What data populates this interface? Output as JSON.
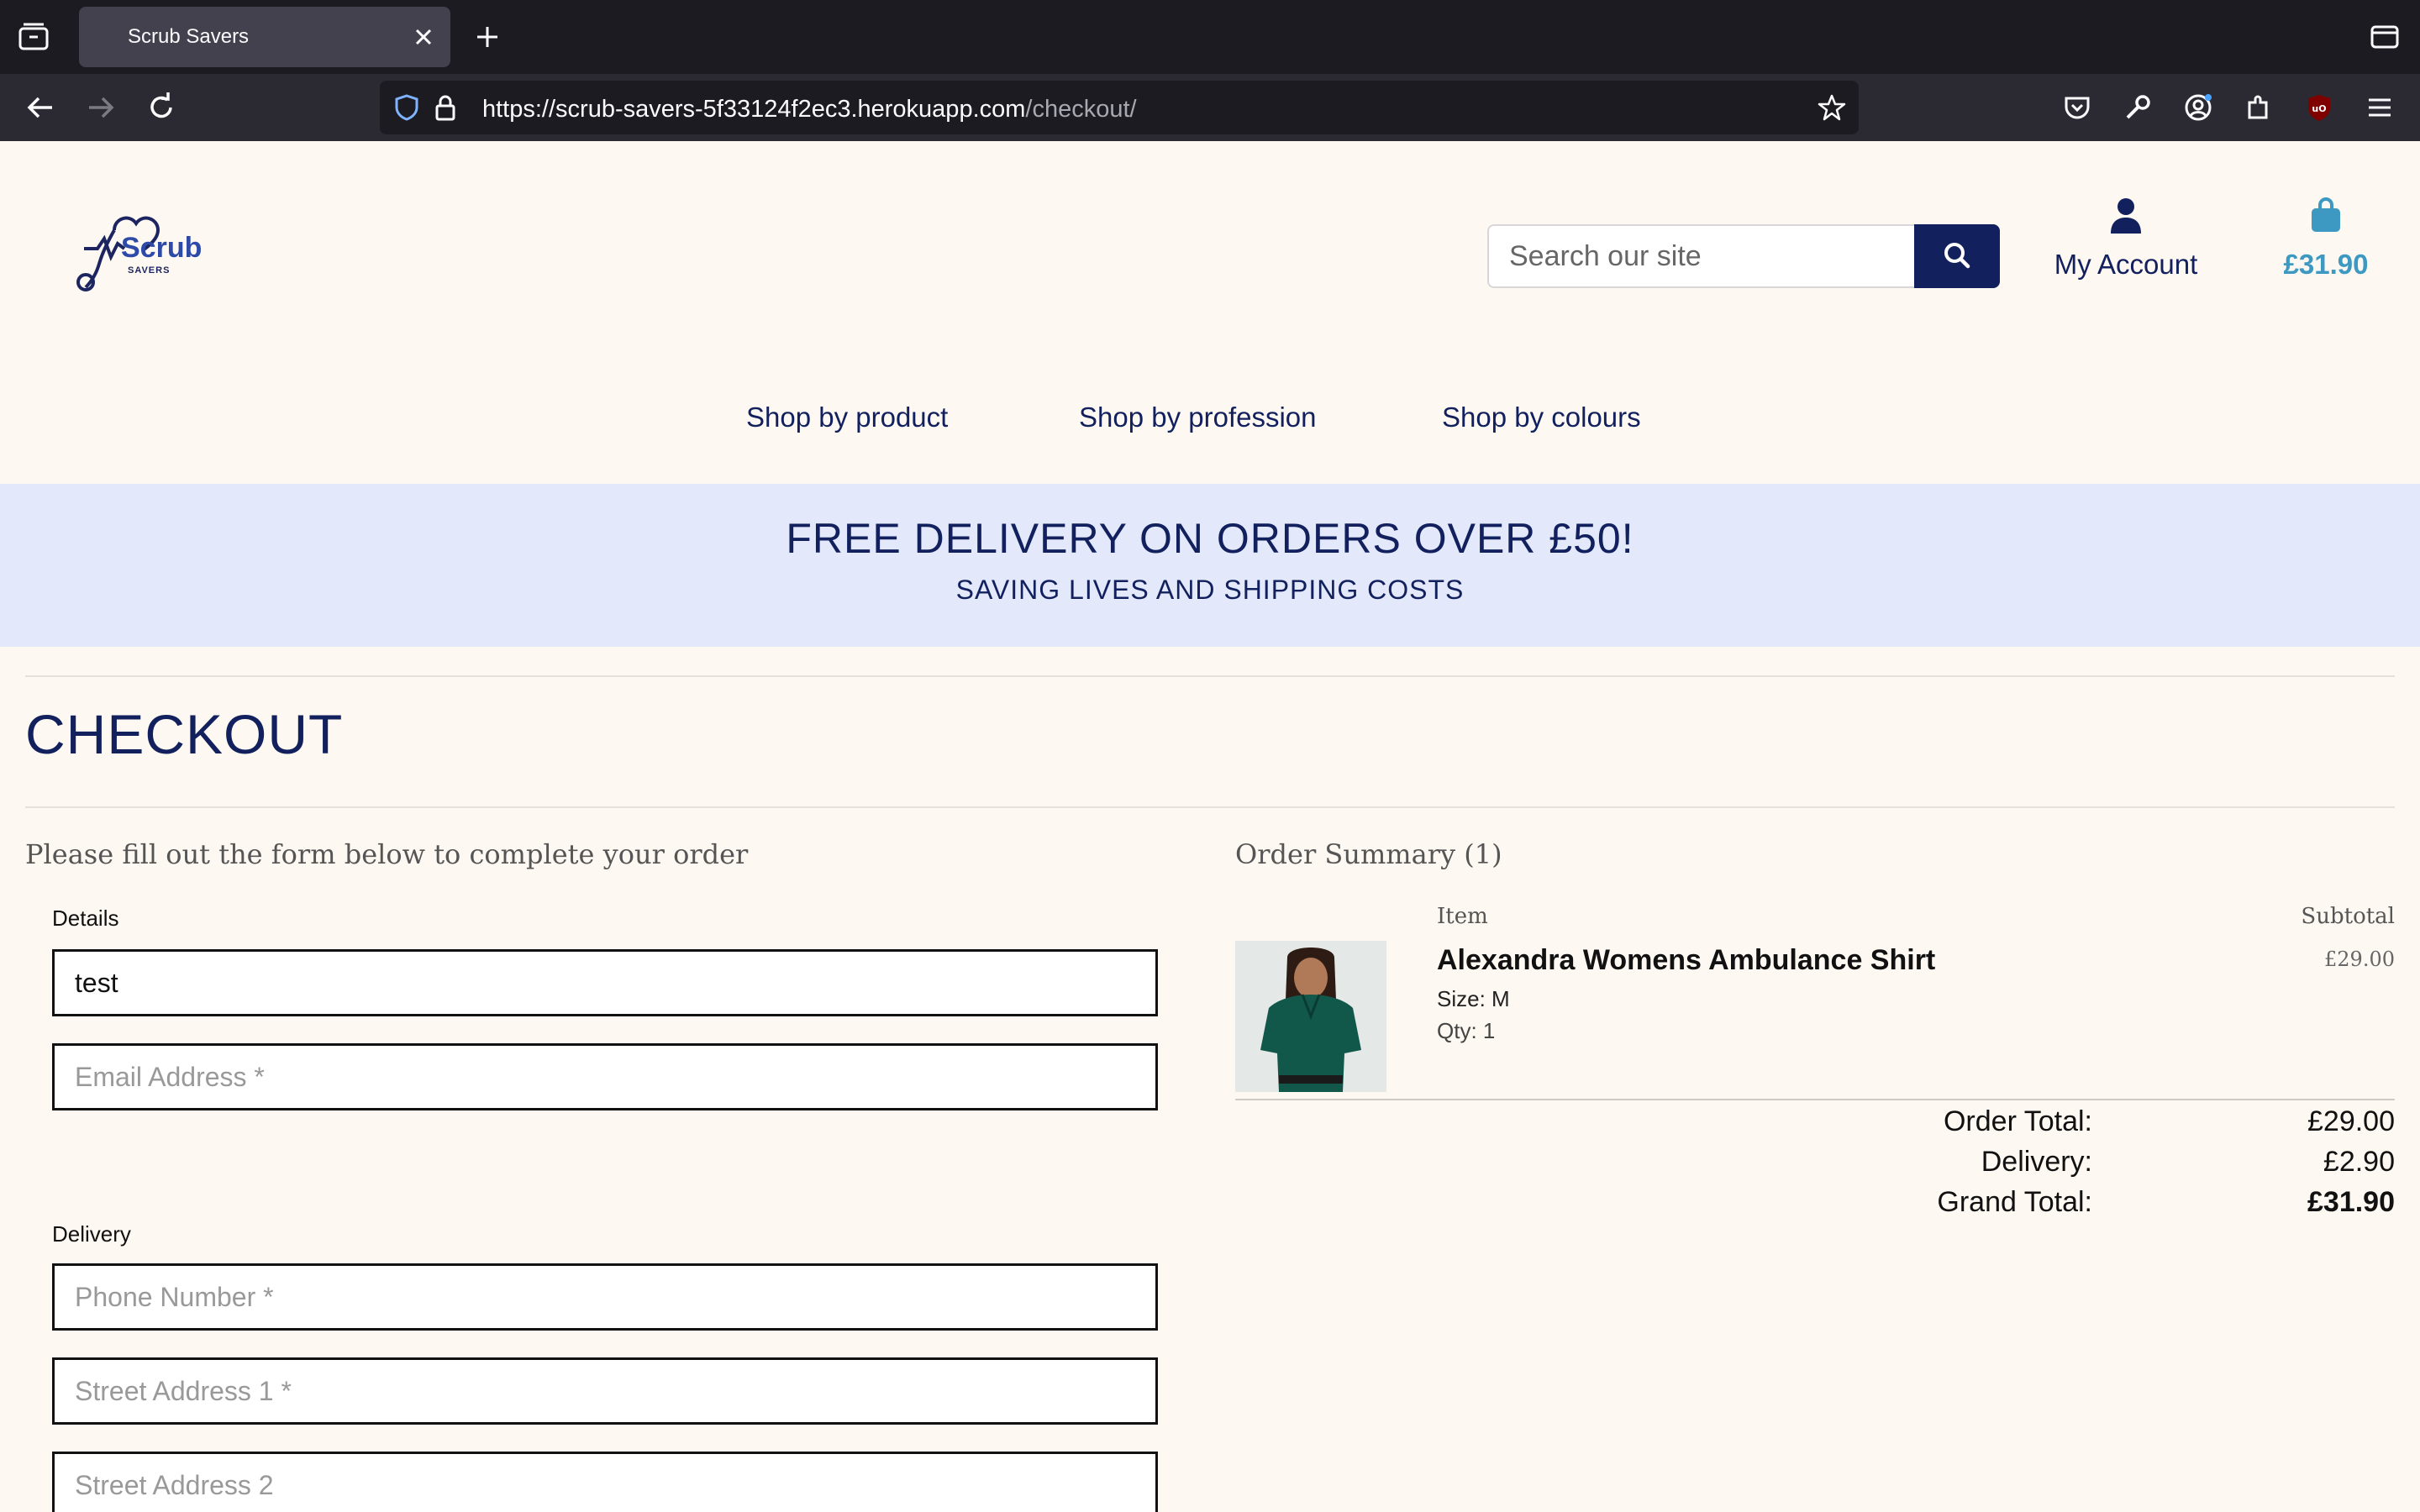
{
  "browser": {
    "tab_title": "Scrub Savers",
    "url_host": "https://scrub-savers-5f33124f2ec3.herokuapp.com",
    "url_path": "/checkout/"
  },
  "site": {
    "logo_text": "Scrub",
    "logo_subtext": "SAVERS",
    "search_placeholder": "Search our site",
    "account_label": "My Account",
    "bag_total": "£31.90",
    "nav": [
      "Shop by product",
      "Shop by profession",
      "Shop by colours"
    ],
    "banner_title": "FREE DELIVERY ON ORDERS OVER £50!",
    "banner_subtitle": "SAVING LIVES AND SHIPPING COSTS",
    "colors": {
      "navy": "#12215e",
      "bag_blue": "#3d99c2",
      "banner_bg": "#e3e9fb",
      "page_bg": "#fdf8f1"
    }
  },
  "checkout": {
    "title": "CHECKOUT",
    "intro": "Please fill out the form below to complete your order",
    "details_label": "Details",
    "full_name_value": "test",
    "email_placeholder": "Email Address *",
    "delivery_label": "Delivery",
    "phone_placeholder": "Phone Number *",
    "street1_placeholder": "Street Address 1 *",
    "street2_placeholder": "Street Address 2"
  },
  "summary": {
    "title": "Order Summary (1)",
    "col_item": "Item",
    "col_subtotal": "Subtotal",
    "item": {
      "name": "Alexandra Womens Ambulance Shirt",
      "size": "Size: M",
      "qty": "Qty: 1",
      "price": "£29.00"
    },
    "order_total_label": "Order Total:",
    "order_total": "£29.00",
    "delivery_label": "Delivery:",
    "delivery": "£2.90",
    "grand_total_label": "Grand Total:",
    "grand_total": "£31.90"
  }
}
